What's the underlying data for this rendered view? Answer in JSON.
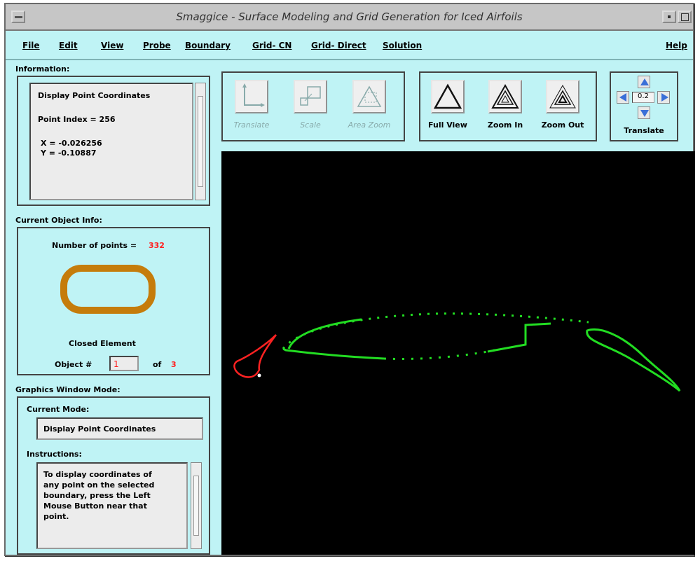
{
  "window": {
    "title": "Smaggice - Surface Modeling and Grid Generation for Iced Airfoils"
  },
  "menu": [
    "File",
    "Edit",
    "View",
    "Probe",
    "Boundary",
    "Grid- CN",
    "Grid- Direct",
    "Solution",
    "Help"
  ],
  "information": {
    "label": "Information:",
    "heading": "Display Point Coordinates",
    "point_index": "Point Index = 256",
    "x": "X = -0.026256",
    "y": "Y = -0.10887"
  },
  "current_object": {
    "label": "Current Object Info:",
    "points_label": "Number of points =",
    "points_value": "332",
    "element_type": "Closed Element",
    "object_label": "Object #",
    "object_value": "1",
    "of_label": "of",
    "of_value": "3",
    "shape_color": "#c57c0b",
    "value_color": "#ff2222"
  },
  "graphics_mode": {
    "label": "Graphics Window Mode:",
    "current_mode_label": "Current Mode:",
    "current_mode_value": "Display Point Coordinates",
    "instructions_label": "Instructions:",
    "instructions_text": "To display coordinates of\nany point on the selected\nboundary, press the Left\nMouse Button near that\npoint."
  },
  "tools_left": [
    {
      "label": "Translate",
      "icon": "axes-icon",
      "enabled": false
    },
    {
      "label": "Scale",
      "icon": "scale-icon",
      "enabled": false
    },
    {
      "label": "Area Zoom",
      "icon": "area-zoom-icon",
      "enabled": false
    }
  ],
  "tools_right": [
    {
      "label": "Full View",
      "icon": "full-view-icon",
      "enabled": true
    },
    {
      "label": "Zoom In",
      "icon": "zoom-in-icon",
      "enabled": true
    },
    {
      "label": "Zoom Out",
      "icon": "zoom-out-icon",
      "enabled": true
    }
  ],
  "translate_pad": {
    "value": "0.2",
    "label": "Translate"
  },
  "colors": {
    "background": "#bff3f5",
    "canvas": "#000000",
    "boundary_main": "#22dd22",
    "boundary_ice": "#ff2222",
    "arrow_blue": "#3a6fd8"
  }
}
